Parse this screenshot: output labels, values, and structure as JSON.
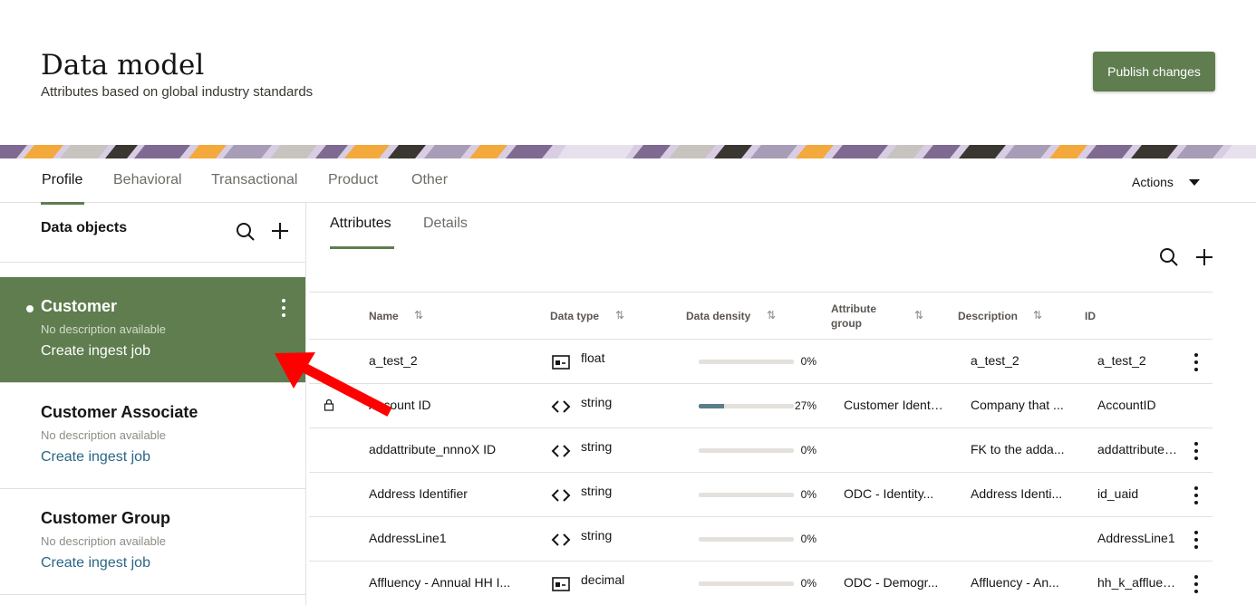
{
  "header": {
    "title": "Data model",
    "subtitle": "Attributes based on global industry standards",
    "publish_label": "Publish changes"
  },
  "tabs": [
    {
      "label": "Profile",
      "active": true
    },
    {
      "label": "Behavioral"
    },
    {
      "label": "Transactional"
    },
    {
      "label": "Product"
    },
    {
      "label": "Other"
    }
  ],
  "actions_label": "Actions",
  "left": {
    "title": "Data objects",
    "objects": [
      {
        "name": "Customer",
        "description": "No description available",
        "link": "Create ingest job",
        "selected": true
      },
      {
        "name": "Customer Associate",
        "description": "No description available",
        "link": "Create ingest job"
      },
      {
        "name": "Customer Group",
        "description": "No description available",
        "link": "Create ingest job"
      }
    ]
  },
  "right": {
    "subtabs": [
      {
        "label": "Attributes",
        "active": true
      },
      {
        "label": "Details"
      }
    ],
    "columns": {
      "name": "Name",
      "data_type": "Data type",
      "data_density": "Data density",
      "attribute_group_line1": "Attribute",
      "attribute_group_line2": "group",
      "description": "Description",
      "id": "ID"
    },
    "rows": [
      {
        "name": "a_test_2",
        "type": "float",
        "type_icon": "number-icon",
        "density": 0,
        "density_label": "0%",
        "group": "",
        "description": "a_test_2",
        "id": "a_test_2",
        "locked": false,
        "menu": true
      },
      {
        "name": "Account ID",
        "type": "string",
        "type_icon": "code-icon",
        "density": 27,
        "density_label": "27%",
        "group": "Customer Identifier",
        "description": "Company that ...",
        "id": "AccountID",
        "locked": true,
        "menu": false
      },
      {
        "name": "addattribute_nnnoX ID",
        "type": "string",
        "type_icon": "code-icon",
        "density": 0,
        "density_label": "0%",
        "group": "",
        "description": "FK to the adda...",
        "id": "addattribute_nnnoX",
        "locked": false,
        "menu": true
      },
      {
        "name": "Address Identifier",
        "type": "string",
        "type_icon": "code-icon",
        "density": 0,
        "density_label": "0%",
        "group": "ODC - Identity...",
        "description": "Address Identi...",
        "id": "id_uaid",
        "locked": false,
        "menu": true
      },
      {
        "name": "AddressLine1",
        "type": "string",
        "type_icon": "code-icon",
        "density": 0,
        "density_label": "0%",
        "group": "",
        "description": "",
        "id": "AddressLine1",
        "locked": false,
        "menu": true
      },
      {
        "name": "Affluency - Annual HH I...",
        "type": "decimal",
        "type_icon": "number-icon",
        "density": 0,
        "density_label": "0%",
        "group": "ODC - Demogr...",
        "description": "Affluency - An...",
        "id": "hh_k_affluency",
        "locked": false,
        "menu": true
      }
    ]
  },
  "annotation": {
    "arrow_color": "#ff0000"
  },
  "colors": {
    "accent": "#5f7d4f",
    "link": "#2a6785",
    "density_fill": "#5a7e8a"
  }
}
